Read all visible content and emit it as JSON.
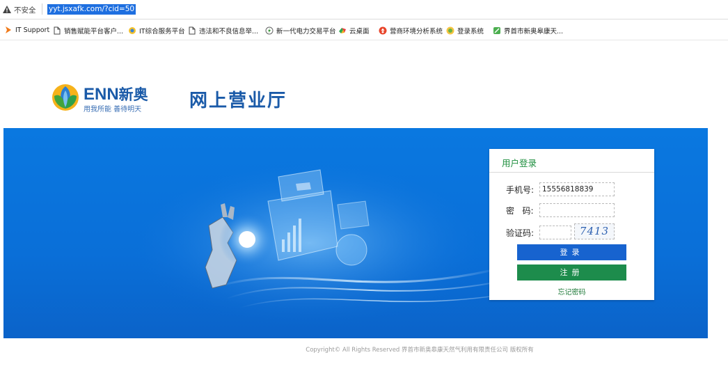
{
  "browser": {
    "insecure_label": "不安全",
    "url": "yyt.jsxafk.com/?cid=50"
  },
  "bookmarks": [
    {
      "label": "IT Support",
      "icon": "arrow-bookmark-icon"
    },
    {
      "label": "销售赋能平台客户...",
      "icon": "page-icon"
    },
    {
      "label": "IT综合服务平台",
      "icon": "globe-icon"
    },
    {
      "label": "违法和不良信息举...",
      "icon": "page-icon"
    },
    {
      "label": "新一代电力交易平台",
      "icon": "power-icon"
    },
    {
      "label": "云桌面",
      "icon": "cloud-desktop-icon"
    },
    {
      "label": "营商环境分析系统",
      "icon": "analysis-icon"
    },
    {
      "label": "登录系统",
      "icon": "login-system-icon"
    },
    {
      "label": "界首市新奥皋康天...",
      "icon": "enn-icon"
    }
  ],
  "header": {
    "logo_en": "ENN",
    "logo_cn": "新奥",
    "slogan": "用我所能 善待明天",
    "site_title": "网上营业厅"
  },
  "login": {
    "title": "用户登录",
    "phone_label": "手机号:",
    "phone_value": "15556818839",
    "password_label": "密   码:",
    "password_value": "",
    "captcha_label": "验证码:",
    "captcha_value": "",
    "captcha_image_text": "7413",
    "login_button": "登录",
    "register_button": "注册",
    "forgot_link": "忘记密码"
  },
  "footer": {
    "copyright": "Copyright© All Rights Reserved  界首市新奥皋康天然气利用有限责任公司  版权所有"
  },
  "colors": {
    "banner": "#0a6fd8",
    "login_button": "#1763cf",
    "register_button": "#1d8c4c",
    "brand_blue": "#1a5aa8",
    "title_green": "#1f8f3f"
  }
}
